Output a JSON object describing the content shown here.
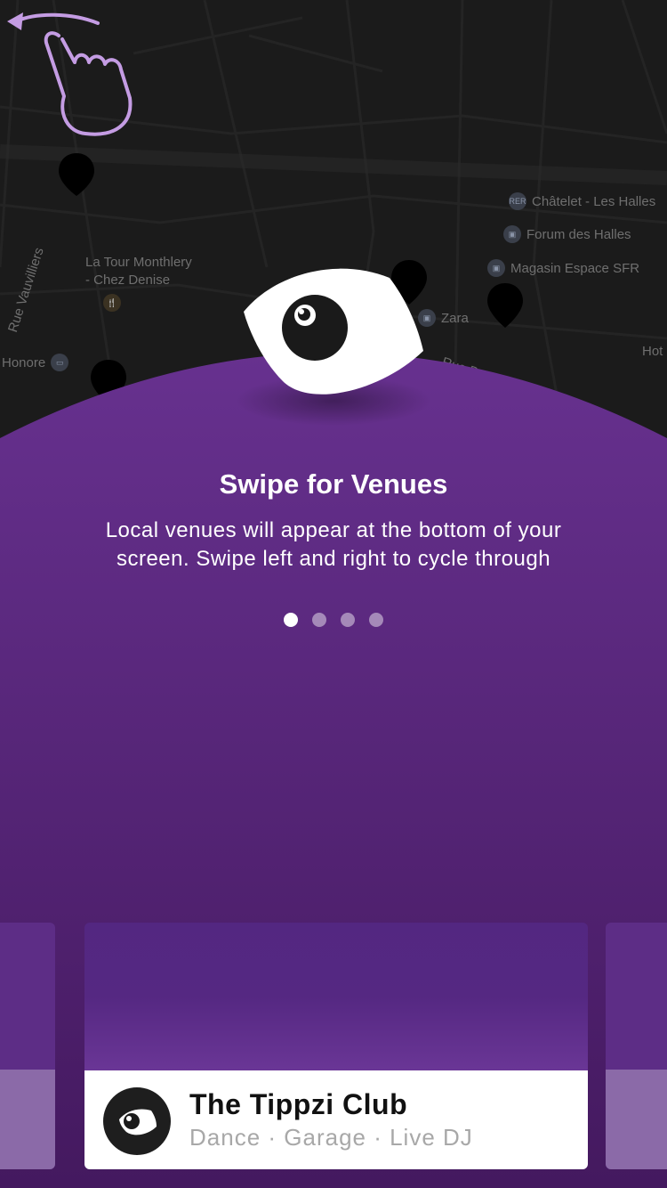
{
  "map": {
    "labels": {
      "chatelet": "Châtelet - Les Halles",
      "forum": "Forum des Halles",
      "magasin": "Magasin Espace SFR",
      "zara": "Zara",
      "rue_berger": "Rue Berger",
      "la_tour": "La Tour Monthlery",
      "chez_denise": "- Chez Denise",
      "honore": "Honore",
      "rue_vauvilliers": "Rue Vauvilliers",
      "hot": "Hot"
    }
  },
  "onboarding": {
    "title": "Swipe for Venues",
    "description": "Local venues will appear at the bottom of your screen. Swipe left and right to cycle through",
    "page_indicator": {
      "current": 1,
      "total": 4
    }
  },
  "venue_card": {
    "name": "The Tippzi Club",
    "tags": "Dance · Garage · Live DJ"
  },
  "colors": {
    "purple_top": "#66308f",
    "purple_bottom": "#4a1d6e",
    "map_bg": "#1b1b1b",
    "card_info_bg": "#ffffff"
  },
  "icons": [
    "eye-icon",
    "swipe-gesture-icon",
    "map-pin-icon",
    "venue-eye-icon"
  ]
}
